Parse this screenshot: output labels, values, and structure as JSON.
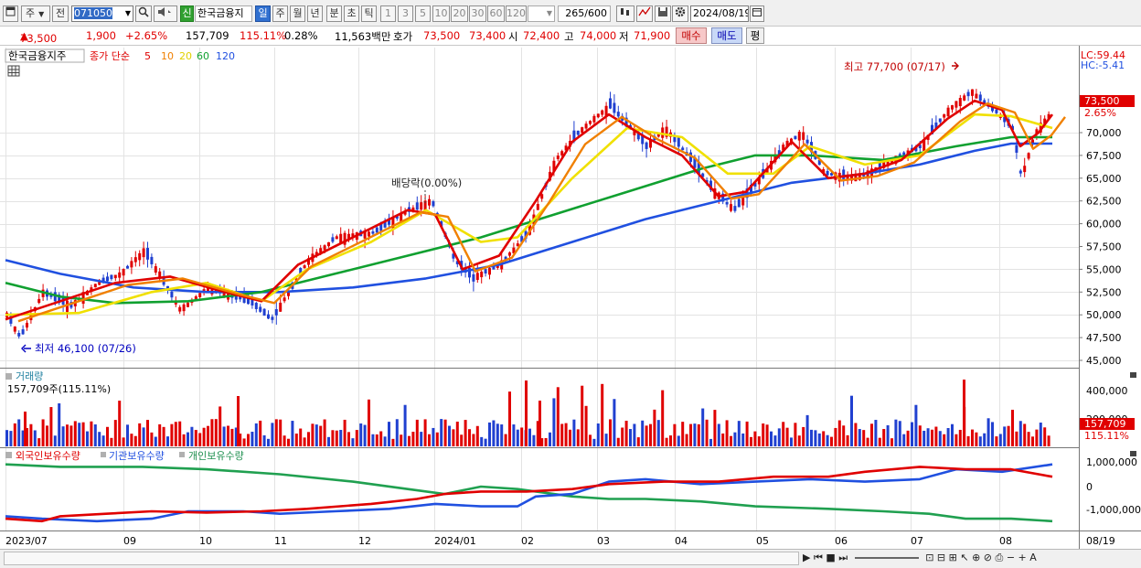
{
  "toolbar": {
    "mode_label": "주",
    "type_label": "전",
    "code_value": "071050",
    "name": "한국금융지",
    "badge": "신",
    "periods": [
      "일",
      "주",
      "월",
      "년",
      "분",
      "초",
      "틱"
    ],
    "active_period": "일",
    "minute_options": [
      "1",
      "3",
      "5",
      "10",
      "20",
      "30",
      "60",
      "120"
    ],
    "count_value": "265",
    "count_total": "/600",
    "date_value": "2024/08/19"
  },
  "quote": {
    "price": "73,500",
    "change": "1,900",
    "change_pct": "+2.65%",
    "volume": "157,709",
    "volume_ratio": "115.11%",
    "turnover": "0.28%",
    "amount": "11,563백만",
    "bid_label": "호가",
    "ask": "73,500",
    "bid": "73,400",
    "open_label": "시",
    "open": "72,400",
    "high_label": "고",
    "high": "74,000",
    "low_label": "저",
    "low": "71,900",
    "buy_label": "매수",
    "sell_label": "매도",
    "avg_label": "평"
  },
  "price_panel": {
    "name": "한국금융지주",
    "ma_title": "종가 단순",
    "ma_periods": [
      "5",
      "10",
      "20",
      "60",
      "120"
    ],
    "ma_colors": [
      "#e00000",
      "#f08000",
      "#f0e000",
      "#10a030",
      "#2050e0"
    ],
    "lc": "LC:59.44",
    "hc": "HC:-5.41",
    "high_note": "최고 77,700 (07/17)",
    "low_note": "최저 46,100 (07/26)",
    "dividend_note": "배당락(0.00%)",
    "cur_price": "73,500",
    "cur_pct": "2.65%",
    "y_ticks": [
      "70,000",
      "67,500",
      "65,000",
      "62,500",
      "60,000",
      "57,500",
      "55,000",
      "52,500",
      "50,000",
      "47,500",
      "45,000"
    ]
  },
  "volume_panel": {
    "title": "거래량",
    "value_line": "157,709주(115.11%)",
    "cur": "157,709",
    "cur_pct": "115.11%",
    "y_ticks": [
      "400,000",
      "200,000"
    ]
  },
  "holdings_panel": {
    "legends": [
      "외국인보유수량",
      "기관보유수량",
      "개인보유수량"
    ],
    "colors": [
      "#e00000",
      "#2050e0",
      "#20a050"
    ],
    "y_ticks": [
      "1,000,000",
      "0",
      "-1,000,000"
    ]
  },
  "x_axis": {
    "labels": [
      "2023/07",
      "09",
      "10",
      "11",
      "12",
      "2024/01",
      "02",
      "03",
      "04",
      "05",
      "06",
      "07",
      "08"
    ],
    "right_label": "08/19"
  },
  "chart_data": {
    "type": "candlestick",
    "title": "한국금융지주",
    "ylim": [
      45000,
      80000
    ],
    "price_points": [
      [
        0,
        50000
      ],
      [
        15,
        47500
      ],
      [
        40,
        52500
      ],
      [
        70,
        51000
      ],
      [
        100,
        53500
      ],
      [
        125,
        54500
      ],
      [
        150,
        57000
      ],
      [
        165,
        54800
      ],
      [
        190,
        50500
      ],
      [
        220,
        53000
      ],
      [
        265,
        51500
      ],
      [
        290,
        49500
      ],
      [
        330,
        56000
      ],
      [
        360,
        58500
      ],
      [
        400,
        59000
      ],
      [
        440,
        61500
      ],
      [
        465,
        62500
      ],
      [
        490,
        56000
      ],
      [
        510,
        54000
      ],
      [
        540,
        55500
      ],
      [
        570,
        59000
      ],
      [
        600,
        67000
      ],
      [
        630,
        70500
      ],
      [
        660,
        73000
      ],
      [
        700,
        68500
      ],
      [
        720,
        70500
      ],
      [
        745,
        67500
      ],
      [
        770,
        64000
      ],
      [
        795,
        61500
      ],
      [
        825,
        65000
      ],
      [
        850,
        68500
      ],
      [
        870,
        70000
      ],
      [
        895,
        65500
      ],
      [
        930,
        65000
      ],
      [
        960,
        66500
      ],
      [
        1000,
        68500
      ],
      [
        1030,
        72500
      ],
      [
        1055,
        74500
      ],
      [
        1080,
        72500
      ],
      [
        1100,
        70500
      ],
      [
        1110,
        65000
      ],
      [
        1125,
        70000
      ],
      [
        1145,
        72500
      ]
    ],
    "ma5": [
      [
        0,
        49500
      ],
      [
        60,
        51500
      ],
      [
        120,
        53500
      ],
      [
        180,
        54200
      ],
      [
        240,
        52500
      ],
      [
        280,
        51500
      ],
      [
        320,
        55500
      ],
      [
        380,
        58500
      ],
      [
        440,
        61500
      ],
      [
        470,
        61000
      ],
      [
        500,
        55000
      ],
      [
        540,
        56500
      ],
      [
        580,
        62500
      ],
      [
        620,
        69000
      ],
      [
        660,
        72000
      ],
      [
        700,
        69500
      ],
      [
        740,
        67500
      ],
      [
        780,
        63000
      ],
      [
        810,
        63500
      ],
      [
        860,
        69000
      ],
      [
        900,
        65000
      ],
      [
        940,
        65500
      ],
      [
        980,
        67000
      ],
      [
        1030,
        71500
      ],
      [
        1060,
        73500
      ],
      [
        1090,
        72500
      ],
      [
        1110,
        68500
      ],
      [
        1130,
        70000
      ],
      [
        1145,
        72000
      ]
    ],
    "ma20": [
      [
        0,
        50000
      ],
      [
        80,
        50200
      ],
      [
        160,
        52500
      ],
      [
        220,
        53500
      ],
      [
        280,
        51500
      ],
      [
        330,
        55000
      ],
      [
        400,
        58000
      ],
      [
        460,
        61500
      ],
      [
        520,
        58000
      ],
      [
        560,
        58500
      ],
      [
        620,
        65000
      ],
      [
        680,
        70500
      ],
      [
        740,
        69500
      ],
      [
        790,
        65500
      ],
      [
        840,
        65500
      ],
      [
        880,
        68500
      ],
      [
        940,
        66500
      ],
      [
        1000,
        67500
      ],
      [
        1060,
        72000
      ],
      [
        1100,
        71800
      ],
      [
        1145,
        70500
      ]
    ],
    "ma60": [
      [
        0,
        53500
      ],
      [
        60,
        52000
      ],
      [
        120,
        51300
      ],
      [
        200,
        51500
      ],
      [
        280,
        52500
      ],
      [
        360,
        54500
      ],
      [
        440,
        56500
      ],
      [
        520,
        58500
      ],
      [
        600,
        61000
      ],
      [
        680,
        63500
      ],
      [
        760,
        66000
      ],
      [
        820,
        67500
      ],
      [
        880,
        67500
      ],
      [
        960,
        67000
      ],
      [
        1040,
        68500
      ],
      [
        1100,
        69500
      ],
      [
        1145,
        69500
      ]
    ],
    "ma120": [
      [
        0,
        56000
      ],
      [
        60,
        54500
      ],
      [
        140,
        53000
      ],
      [
        220,
        52500
      ],
      [
        300,
        52500
      ],
      [
        380,
        53000
      ],
      [
        460,
        54000
      ],
      [
        540,
        55500
      ],
      [
        620,
        58000
      ],
      [
        700,
        60500
      ],
      [
        780,
        62500
      ],
      [
        860,
        64500
      ],
      [
        940,
        65500
      ],
      [
        1000,
        66500
      ],
      [
        1060,
        68000
      ],
      [
        1100,
        68800
      ],
      [
        1145,
        68800
      ]
    ],
    "foreign": [
      [
        0,
        -1300000
      ],
      [
        40,
        -1400000
      ],
      [
        60,
        -1200000
      ],
      [
        110,
        -1100000
      ],
      [
        160,
        -1000000
      ],
      [
        220,
        -1050000
      ],
      [
        280,
        -1000000
      ],
      [
        330,
        -900000
      ],
      [
        400,
        -700000
      ],
      [
        450,
        -500000
      ],
      [
        480,
        -300000
      ],
      [
        520,
        -200000
      ],
      [
        570,
        -200000
      ],
      [
        620,
        -100000
      ],
      [
        660,
        100000
      ],
      [
        720,
        200000
      ],
      [
        780,
        200000
      ],
      [
        840,
        400000
      ],
      [
        900,
        400000
      ],
      [
        940,
        600000
      ],
      [
        1000,
        800000
      ],
      [
        1050,
        700000
      ],
      [
        1100,
        700000
      ],
      [
        1145,
        400000
      ]
    ],
    "institution": [
      [
        0,
        -1200000
      ],
      [
        40,
        -1300000
      ],
      [
        100,
        -1400000
      ],
      [
        160,
        -1300000
      ],
      [
        200,
        -1000000
      ],
      [
        260,
        -1000000
      ],
      [
        300,
        -1100000
      ],
      [
        360,
        -1000000
      ],
      [
        420,
        -900000
      ],
      [
        470,
        -700000
      ],
      [
        520,
        -800000
      ],
      [
        560,
        -800000
      ],
      [
        580,
        -400000
      ],
      [
        620,
        -300000
      ],
      [
        660,
        200000
      ],
      [
        700,
        300000
      ],
      [
        760,
        100000
      ],
      [
        820,
        200000
      ],
      [
        880,
        300000
      ],
      [
        940,
        200000
      ],
      [
        1000,
        300000
      ],
      [
        1040,
        700000
      ],
      [
        1090,
        600000
      ],
      [
        1145,
        900000
      ]
    ],
    "individual": [
      [
        0,
        900000
      ],
      [
        60,
        800000
      ],
      [
        150,
        800000
      ],
      [
        220,
        700000
      ],
      [
        300,
        500000
      ],
      [
        380,
        200000
      ],
      [
        440,
        -100000
      ],
      [
        480,
        -300000
      ],
      [
        520,
        0
      ],
      [
        560,
        -100000
      ],
      [
        620,
        -400000
      ],
      [
        660,
        -500000
      ],
      [
        700,
        -500000
      ],
      [
        760,
        -600000
      ],
      [
        820,
        -800000
      ],
      [
        900,
        -900000
      ],
      [
        960,
        -1000000
      ],
      [
        1010,
        -1100000
      ],
      [
        1050,
        -1300000
      ],
      [
        1100,
        -1300000
      ],
      [
        1145,
        -1400000
      ]
    ]
  }
}
